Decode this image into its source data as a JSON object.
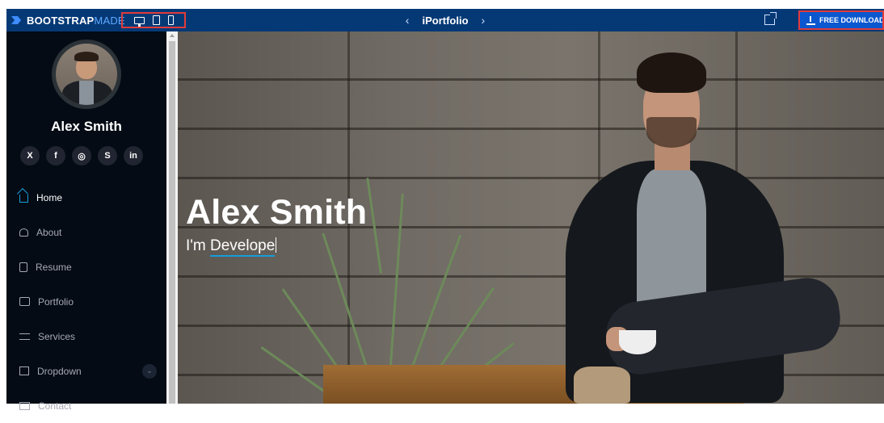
{
  "topbar": {
    "brand_main": "BOOTSTRAP",
    "brand_suffix": "MADE",
    "preview_title": "iPortfolio",
    "prev_arrow": "‹",
    "next_arrow": "›",
    "download_label": "FREE DOWNLOAD"
  },
  "sidebar": {
    "name": "Alex Smith",
    "socials": [
      {
        "label": "X",
        "icon": "x-twitter-icon"
      },
      {
        "label": "f",
        "icon": "facebook-icon"
      },
      {
        "label": "◎",
        "icon": "instagram-icon"
      },
      {
        "label": "S",
        "icon": "skype-icon"
      },
      {
        "label": "in",
        "icon": "linkedin-icon"
      }
    ],
    "nav": [
      {
        "label": "Home",
        "icon": "home-icon",
        "active": true
      },
      {
        "label": "About",
        "icon": "person-icon"
      },
      {
        "label": "Resume",
        "icon": "file-icon"
      },
      {
        "label": "Portfolio",
        "icon": "images-icon"
      },
      {
        "label": "Services",
        "icon": "server-icon"
      },
      {
        "label": "Dropdown",
        "icon": "menu-icon",
        "chevron": "⌄"
      },
      {
        "label": "Contact",
        "icon": "envelope-icon"
      }
    ]
  },
  "hero": {
    "title": "Alex Smith",
    "subtitle_prefix": "I'm ",
    "typed_text": "Develope"
  },
  "colors": {
    "topbar_bg": "#053976",
    "accent": "#149ddd",
    "sidebar_bg": "#040b14",
    "download_bg": "#0a57cf",
    "highlight_border": "#e03b3b"
  }
}
